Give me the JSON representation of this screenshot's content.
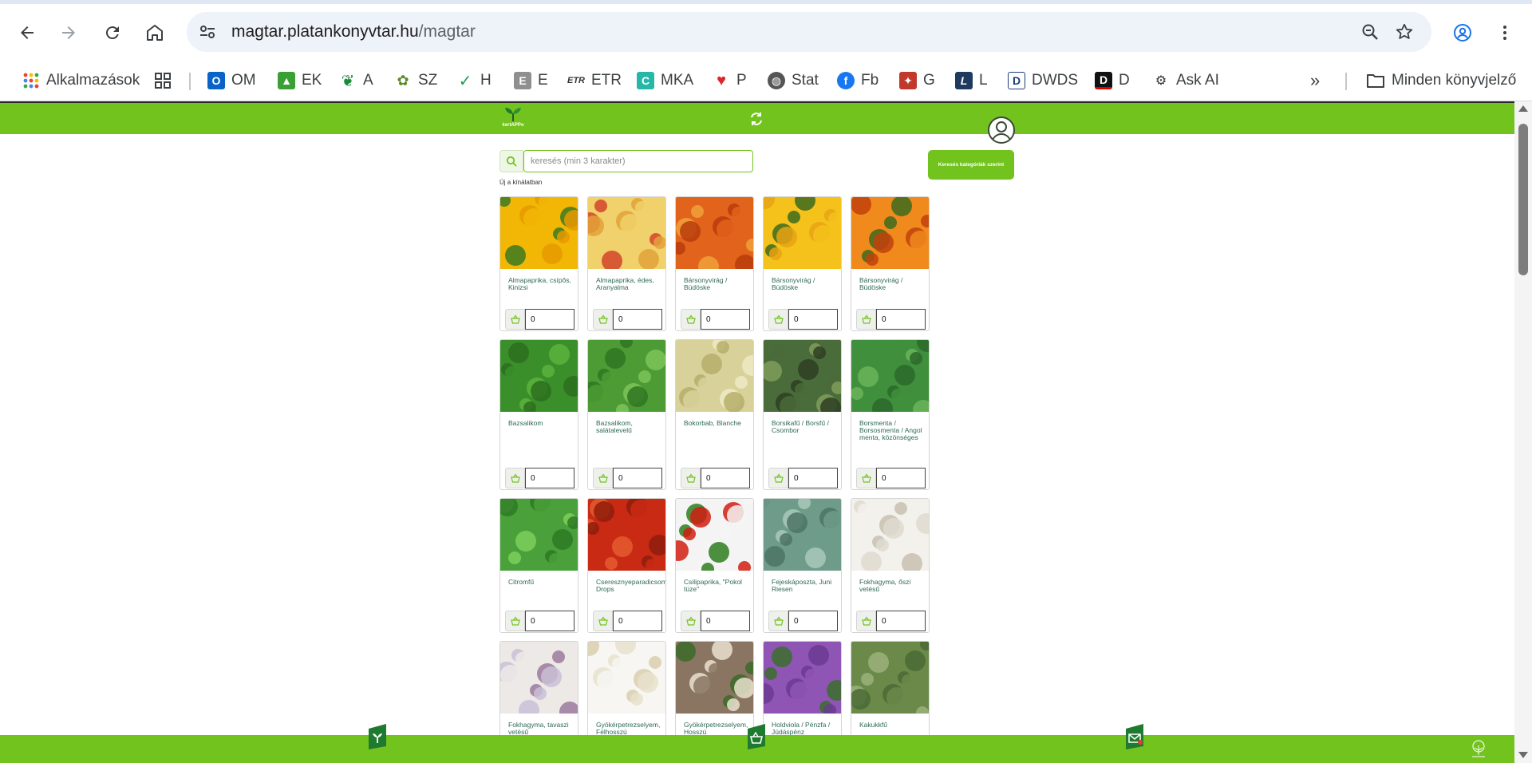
{
  "browser": {
    "url_host": "magtar.platankonyvtar.hu",
    "url_path": "/magtar",
    "bookmarks": [
      {
        "label": "Alkalmazások",
        "icon": "apps-grid-icon"
      },
      {
        "label": "",
        "icon": "tab-groups-icon"
      },
      {
        "label": "OM",
        "icon": "outlook-icon"
      },
      {
        "label": "EK",
        "icon": "ek-icon"
      },
      {
        "label": "A",
        "icon": "leaf-icon"
      },
      {
        "label": "SZ",
        "icon": "plant-icon"
      },
      {
        "label": "H",
        "icon": "check-icon"
      },
      {
        "label": "E",
        "icon": "e-icon"
      },
      {
        "label": "ETR",
        "icon": "etr-icon"
      },
      {
        "label": "MKA",
        "icon": "mka-icon"
      },
      {
        "label": "P",
        "icon": "heart-icon"
      },
      {
        "label": "Stat",
        "icon": "globe-icon"
      },
      {
        "label": "Fb",
        "icon": "facebook-icon"
      },
      {
        "label": "G",
        "icon": "g-icon"
      },
      {
        "label": "L",
        "icon": "l-icon"
      },
      {
        "label": "DWDS",
        "icon": "dwds-icon"
      },
      {
        "label": "D",
        "icon": "d-icon"
      },
      {
        "label": "Ask AI",
        "icon": "ai-icon"
      }
    ],
    "overflow_label": "»",
    "all_bookmarks_label": "Minden könyvjelző"
  },
  "app": {
    "logo_text": "kertAPPo",
    "search_placeholder": "keresés (min 3 karakter)",
    "category_button": "Keresés kategóriák szerint",
    "section_title": "Új a kínálatban",
    "brand_color": "#73c31e",
    "products": [
      {
        "name": "Almapaprika, csípős, Kinizsi",
        "qty": "0",
        "palette": "yellow-pepper"
      },
      {
        "name": "Almapaprika, édes, Aranyalma",
        "qty": "0",
        "palette": "apple-pepper"
      },
      {
        "name": "Bársonyvirág / Büdöske",
        "qty": "0",
        "palette": "orange-flower"
      },
      {
        "name": "Bársonyvirág / Büdöske",
        "qty": "0",
        "palette": "yellow-flower"
      },
      {
        "name": "Bársonyvirág / Büdöske",
        "qty": "0",
        "palette": "orange-flower2"
      },
      {
        "name": "Bazsalikom",
        "qty": "0",
        "palette": "basil"
      },
      {
        "name": "Bazsalikom, salátalevelű",
        "qty": "0",
        "palette": "basil2"
      },
      {
        "name": "Bokorbab, Blanche",
        "qty": "0",
        "palette": "beans"
      },
      {
        "name": "Borsikafű / Borsfű / Csombor",
        "qty": "0",
        "palette": "savory"
      },
      {
        "name": "Borsmenta / Borsosmenta / Angol menta, közönséges",
        "qty": "0",
        "palette": "mint"
      },
      {
        "name": "Citromfű",
        "qty": "0",
        "palette": "lemonbalm"
      },
      {
        "name": "Cseresznyeparadicsom, Drops",
        "qty": "0",
        "palette": "tomato"
      },
      {
        "name": "Csilipaprika, \"Pokol tüze\"",
        "qty": "0",
        "palette": "chili"
      },
      {
        "name": "Fejeskáposzta, Juni Riesen",
        "qty": "0",
        "palette": "cabbage"
      },
      {
        "name": "Fokhagyma, őszi vetésű",
        "qty": "0",
        "palette": "garlic"
      },
      {
        "name": "Fokhagyma, tavaszi vetésű",
        "qty": "",
        "palette": "garlic2"
      },
      {
        "name": "Gyökérpetrezselyem, Félhosszú",
        "qty": "",
        "palette": "parsnip"
      },
      {
        "name": "Gyökérpetrezselyem, Hosszú",
        "qty": "",
        "palette": "parsnip2"
      },
      {
        "name": "Holdviola / Pénzfa / Júdáspénz",
        "qty": "",
        "palette": "violet"
      },
      {
        "name": "Kakukkfű",
        "qty": "",
        "palette": "thyme"
      }
    ]
  }
}
